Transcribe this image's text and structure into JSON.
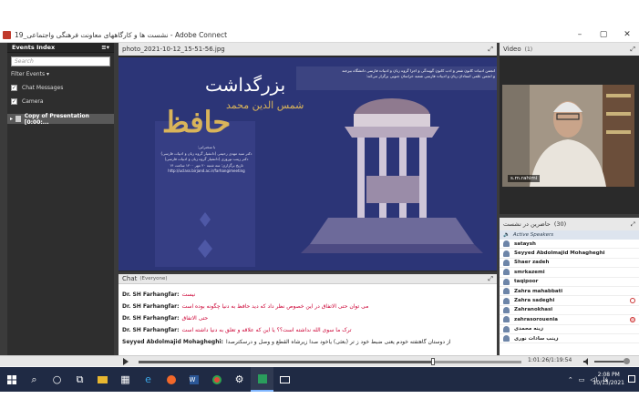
{
  "window": {
    "title": "نشست ها و کارگاههای معاونت فرهنگی واجتماعی_19 - Adobe Connect",
    "minimize": "–",
    "maximize": "▢",
    "close": "✕"
  },
  "events_pod": {
    "title": "Events Index",
    "menu": "≡▾",
    "search_placeholder": "Search",
    "filter_label": "Filter Events ▾",
    "options": [
      {
        "label": "Chat Messages",
        "checked": true
      },
      {
        "label": "Camera",
        "checked": true
      }
    ],
    "item_label": "Copy of Presentation [0:00:..."
  },
  "share_pod": {
    "title": "photo_2021-10-12_15-51-56.jpg",
    "poster": {
      "heading": "بزرگداشت",
      "subheading": "شمس الدين محمد",
      "calligraphy": "حافظ",
      "description_line1": "انجمن ادبیات کانون شعر و ادب کانون گویندگی و اجرا گروه زبان و ادبیات فارسی دانشگاه بیرجند",
      "description_line2": "و انجمن علمی استادان زبان و ادبیات فارسی شعبه خراسان جنوبی برگزار می‌کند:",
      "speakers_title": "با سخنرانی:",
      "speaker1": "دکتر سید مهدی رحیمی (دانشیار گروه زبان و ادبیات فارسی)",
      "speaker2": "دکتر زینب نوروزی (دانشیار گروه زبان و ادبیات فارسی)",
      "date_line": "تاریخ برگزاری: سه شنبه ۲۰ مهر ۱۴۰۰ ساعت ۱۴",
      "url": "http://uclass.birjand.ac.ir/farhangimeeting"
    }
  },
  "chat_pod": {
    "title": "Chat",
    "scope": "(Everyone)",
    "messages": [
      {
        "sender": "Dr. SH Farhangfar:",
        "text": "نیست"
      },
      {
        "sender": "Dr. SH Farhangfar:",
        "text": "می توان حتی الاتفاق در این خصوص نظر داد که دید حافظ به دنیا چگونه بوده است"
      },
      {
        "sender": "Dr. SH Farhangfar:",
        "text": "حتی الاتفاق"
      },
      {
        "sender": "Dr. SH Farhangfar:",
        "text": "ترک ما سوی الله نداشته است؟؟ یا این که علاقه و تعلق به دنیا داشته است"
      },
      {
        "sender": "Seyyed Abdolmajid Mohagheghi:",
        "text": "از دوستان گاهتفته خودم یعنی ضبط خود ز تر (بعثی) یاخود صدا زیرشاه القطع و وصل و درسکترصدا"
      }
    ]
  },
  "video_pod": {
    "title": "Video",
    "count": "(1)",
    "name_tag": "s.m.rahimi"
  },
  "attendees_pod": {
    "title": "حاضرین در نشست",
    "count": "(30)",
    "group_label": "Active Speakers",
    "attendees": [
      {
        "name": "sataysh",
        "status": "none"
      },
      {
        "name": "Seyyed Abdolmajid Mohagheghi",
        "status": "none"
      },
      {
        "name": "Shaer zadeh",
        "status": "none"
      },
      {
        "name": "smrkazemi",
        "status": "none"
      },
      {
        "name": "taqipoor",
        "status": "none"
      },
      {
        "name": "Zahra mahabbati",
        "status": "none"
      },
      {
        "name": "Zahra sadeghi",
        "status": "away"
      },
      {
        "name": "Zahranokhasi",
        "status": "none"
      },
      {
        "name": "zahrasorouenia",
        "status": "raised"
      },
      {
        "name": "زینه محمدی",
        "status": "none"
      },
      {
        "name": "زینب سادات نوری",
        "status": "none"
      }
    ]
  },
  "playback": {
    "time": "1:01:26/1:19:54",
    "progress": 0.77
  },
  "taskbar": {
    "start_icon": "windows-logo",
    "tray_language": "فا",
    "time": "2:08 PM",
    "date": "10/13/2021"
  },
  "colors": {
    "poster_bg": "#2c3577",
    "poster_gold": "#d9b45a",
    "pod_header": "#e8e8e8",
    "chat_red": "#cc0033",
    "taskbar": "#1f2a44"
  }
}
